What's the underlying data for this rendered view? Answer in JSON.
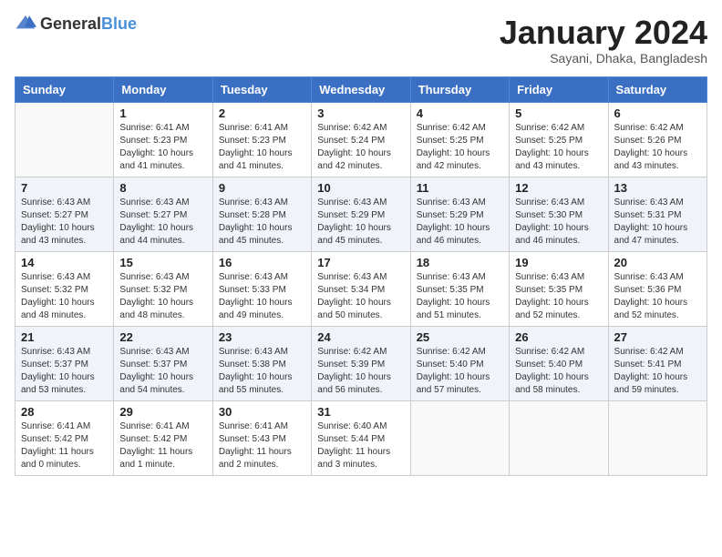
{
  "header": {
    "logo_general": "General",
    "logo_blue": "Blue",
    "month_title": "January 2024",
    "subtitle": "Sayani, Dhaka, Bangladesh"
  },
  "days_of_week": [
    "Sunday",
    "Monday",
    "Tuesday",
    "Wednesday",
    "Thursday",
    "Friday",
    "Saturday"
  ],
  "weeks": [
    [
      {
        "day": "",
        "info": ""
      },
      {
        "day": "1",
        "info": "Sunrise: 6:41 AM\nSunset: 5:23 PM\nDaylight: 10 hours\nand 41 minutes."
      },
      {
        "day": "2",
        "info": "Sunrise: 6:41 AM\nSunset: 5:23 PM\nDaylight: 10 hours\nand 41 minutes."
      },
      {
        "day": "3",
        "info": "Sunrise: 6:42 AM\nSunset: 5:24 PM\nDaylight: 10 hours\nand 42 minutes."
      },
      {
        "day": "4",
        "info": "Sunrise: 6:42 AM\nSunset: 5:25 PM\nDaylight: 10 hours\nand 42 minutes."
      },
      {
        "day": "5",
        "info": "Sunrise: 6:42 AM\nSunset: 5:25 PM\nDaylight: 10 hours\nand 43 minutes."
      },
      {
        "day": "6",
        "info": "Sunrise: 6:42 AM\nSunset: 5:26 PM\nDaylight: 10 hours\nand 43 minutes."
      }
    ],
    [
      {
        "day": "7",
        "info": "Sunrise: 6:43 AM\nSunset: 5:27 PM\nDaylight: 10 hours\nand 43 minutes."
      },
      {
        "day": "8",
        "info": "Sunrise: 6:43 AM\nSunset: 5:27 PM\nDaylight: 10 hours\nand 44 minutes."
      },
      {
        "day": "9",
        "info": "Sunrise: 6:43 AM\nSunset: 5:28 PM\nDaylight: 10 hours\nand 45 minutes."
      },
      {
        "day": "10",
        "info": "Sunrise: 6:43 AM\nSunset: 5:29 PM\nDaylight: 10 hours\nand 45 minutes."
      },
      {
        "day": "11",
        "info": "Sunrise: 6:43 AM\nSunset: 5:29 PM\nDaylight: 10 hours\nand 46 minutes."
      },
      {
        "day": "12",
        "info": "Sunrise: 6:43 AM\nSunset: 5:30 PM\nDaylight: 10 hours\nand 46 minutes."
      },
      {
        "day": "13",
        "info": "Sunrise: 6:43 AM\nSunset: 5:31 PM\nDaylight: 10 hours\nand 47 minutes."
      }
    ],
    [
      {
        "day": "14",
        "info": "Sunrise: 6:43 AM\nSunset: 5:32 PM\nDaylight: 10 hours\nand 48 minutes."
      },
      {
        "day": "15",
        "info": "Sunrise: 6:43 AM\nSunset: 5:32 PM\nDaylight: 10 hours\nand 48 minutes."
      },
      {
        "day": "16",
        "info": "Sunrise: 6:43 AM\nSunset: 5:33 PM\nDaylight: 10 hours\nand 49 minutes."
      },
      {
        "day": "17",
        "info": "Sunrise: 6:43 AM\nSunset: 5:34 PM\nDaylight: 10 hours\nand 50 minutes."
      },
      {
        "day": "18",
        "info": "Sunrise: 6:43 AM\nSunset: 5:35 PM\nDaylight: 10 hours\nand 51 minutes."
      },
      {
        "day": "19",
        "info": "Sunrise: 6:43 AM\nSunset: 5:35 PM\nDaylight: 10 hours\nand 52 minutes."
      },
      {
        "day": "20",
        "info": "Sunrise: 6:43 AM\nSunset: 5:36 PM\nDaylight: 10 hours\nand 52 minutes."
      }
    ],
    [
      {
        "day": "21",
        "info": "Sunrise: 6:43 AM\nSunset: 5:37 PM\nDaylight: 10 hours\nand 53 minutes."
      },
      {
        "day": "22",
        "info": "Sunrise: 6:43 AM\nSunset: 5:37 PM\nDaylight: 10 hours\nand 54 minutes."
      },
      {
        "day": "23",
        "info": "Sunrise: 6:43 AM\nSunset: 5:38 PM\nDaylight: 10 hours\nand 55 minutes."
      },
      {
        "day": "24",
        "info": "Sunrise: 6:42 AM\nSunset: 5:39 PM\nDaylight: 10 hours\nand 56 minutes."
      },
      {
        "day": "25",
        "info": "Sunrise: 6:42 AM\nSunset: 5:40 PM\nDaylight: 10 hours\nand 57 minutes."
      },
      {
        "day": "26",
        "info": "Sunrise: 6:42 AM\nSunset: 5:40 PM\nDaylight: 10 hours\nand 58 minutes."
      },
      {
        "day": "27",
        "info": "Sunrise: 6:42 AM\nSunset: 5:41 PM\nDaylight: 10 hours\nand 59 minutes."
      }
    ],
    [
      {
        "day": "28",
        "info": "Sunrise: 6:41 AM\nSunset: 5:42 PM\nDaylight: 11 hours\nand 0 minutes."
      },
      {
        "day": "29",
        "info": "Sunrise: 6:41 AM\nSunset: 5:42 PM\nDaylight: 11 hours\nand 1 minute."
      },
      {
        "day": "30",
        "info": "Sunrise: 6:41 AM\nSunset: 5:43 PM\nDaylight: 11 hours\nand 2 minutes."
      },
      {
        "day": "31",
        "info": "Sunrise: 6:40 AM\nSunset: 5:44 PM\nDaylight: 11 hours\nand 3 minutes."
      },
      {
        "day": "",
        "info": ""
      },
      {
        "day": "",
        "info": ""
      },
      {
        "day": "",
        "info": ""
      }
    ]
  ]
}
